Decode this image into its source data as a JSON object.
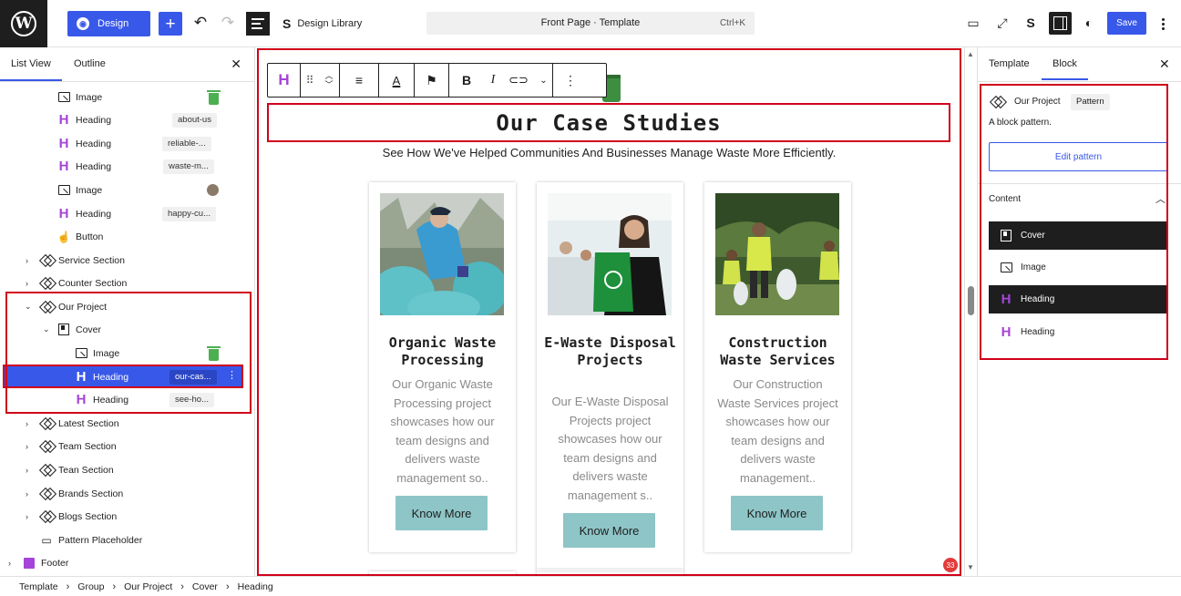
{
  "topbar": {
    "design_label": "Design",
    "library_label": "Design Library",
    "command": "Front Page · Template",
    "shortcut": "Ctrl+K",
    "save_label": "Save"
  },
  "left_panel": {
    "tabs": [
      "List View",
      "Outline"
    ],
    "rows": [
      {
        "label": "Image",
        "anchor": "",
        "icon": "image-icon"
      },
      {
        "label": "Heading",
        "anchor": "about-us",
        "icon": "heading-icon"
      },
      {
        "label": "Heading",
        "anchor": "reliable-...",
        "icon": "heading-icon"
      },
      {
        "label": "Heading",
        "anchor": "waste-m...",
        "icon": "heading-icon"
      },
      {
        "label": "Image",
        "anchor": "",
        "icon": "image-icon"
      },
      {
        "label": "Heading",
        "anchor": "happy-cu...",
        "icon": "heading-icon"
      },
      {
        "label": "Button",
        "anchor": "",
        "icon": "button-icon"
      },
      {
        "label": "Service Section",
        "anchor": "",
        "icon": "pattern-icon"
      },
      {
        "label": "Counter Section",
        "anchor": "",
        "icon": "pattern-icon"
      },
      {
        "label": "Our Project",
        "anchor": "",
        "icon": "pattern-icon"
      },
      {
        "label": "Cover",
        "anchor": "",
        "icon": "cover-icon"
      },
      {
        "label": "Image",
        "anchor": "",
        "icon": "image-icon"
      },
      {
        "label": "Heading",
        "anchor": "our-cas...",
        "icon": "heading-icon"
      },
      {
        "label": "Heading",
        "anchor": "see-ho...",
        "icon": "heading-icon"
      },
      {
        "label": "Latest Section",
        "anchor": "",
        "icon": "pattern-icon"
      },
      {
        "label": "Team Section",
        "anchor": "",
        "icon": "pattern-icon"
      },
      {
        "label": "Tean Section",
        "anchor": "",
        "icon": "pattern-icon"
      },
      {
        "label": "Brands Section",
        "anchor": "",
        "icon": "pattern-icon"
      },
      {
        "label": "Blogs Section",
        "anchor": "",
        "icon": "pattern-icon"
      },
      {
        "label": "Pattern Placeholder",
        "anchor": "",
        "icon": "placeholder-icon"
      },
      {
        "label": "Footer",
        "anchor": "",
        "icon": "footer-icon"
      }
    ]
  },
  "canvas": {
    "heading": "Our Case Studies",
    "subheading": "See How We've Helped Communities And Businesses Manage Waste More Efficiently.",
    "badge": "33",
    "cards": [
      {
        "title": "Organic Waste Processing",
        "text": "Our Organic Waste Processing project showcases how our team designs and delivers waste management so..",
        "button": "Know More"
      },
      {
        "title": "E-Waste Disposal Projects",
        "text": "Our E-Waste Disposal Projects project showcases how our team designs and delivers waste management s..",
        "button": "Know More"
      },
      {
        "title": "Construction Waste Services",
        "text": "Our Construction Waste Services project showcases how our team designs and delivers waste management..",
        "button": "Know More"
      }
    ]
  },
  "right_panel": {
    "tabs": [
      "Template",
      "Block"
    ],
    "pattern_name": "Our Project",
    "pattern_badge": "Pattern",
    "description": "A block pattern.",
    "edit_label": "Edit pattern",
    "content_label": "Content",
    "content_items": [
      {
        "label": "Cover",
        "icon": "cover-icon"
      },
      {
        "label": "Image",
        "icon": "image-icon"
      },
      {
        "label": "Heading",
        "icon": "heading-icon"
      },
      {
        "label": "Heading",
        "icon": "heading-icon"
      }
    ]
  },
  "breadcrumb": [
    "Template",
    "Group",
    "Our Project",
    "Cover",
    "Heading"
  ],
  "colors": {
    "accent": "#3858e9",
    "highlight_border": "#d0021b",
    "heading_icon": "#a544d8",
    "card_button": "#8ec5c7"
  }
}
